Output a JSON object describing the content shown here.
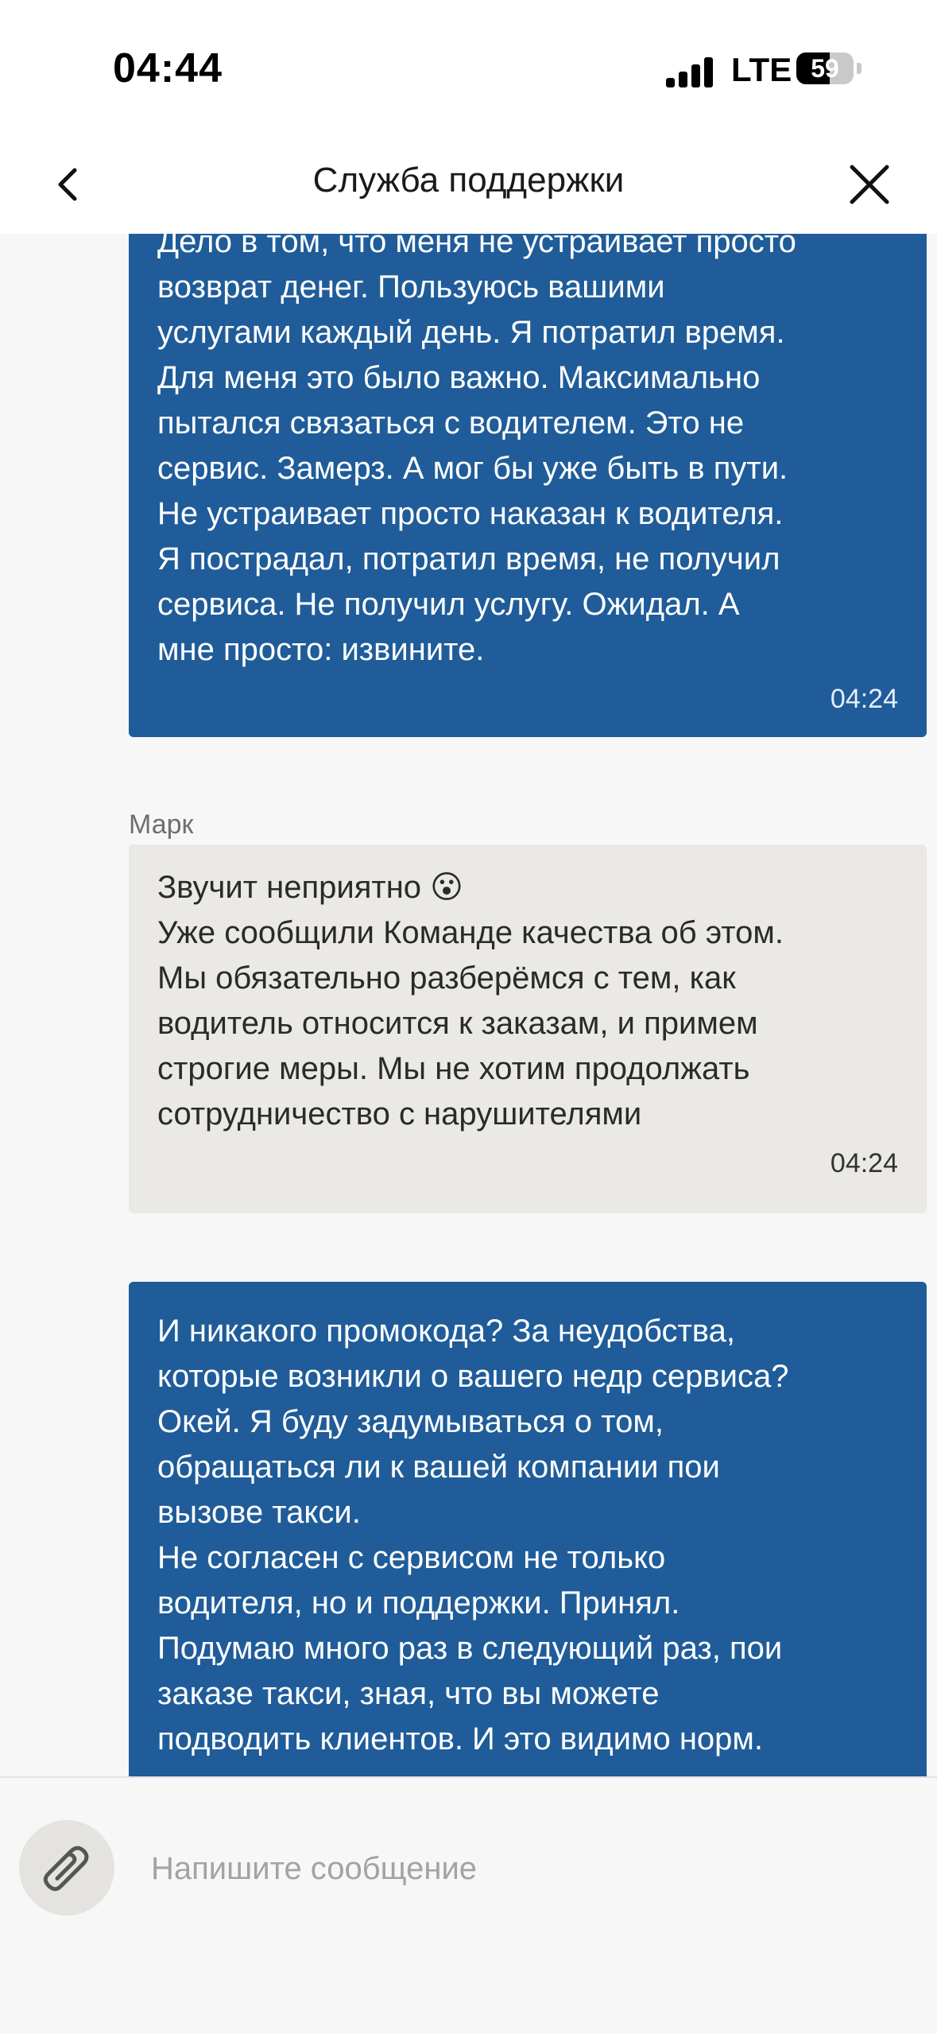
{
  "status_bar": {
    "time": "04:44",
    "network": "LTE",
    "battery": "59",
    "battery_level": 0.59
  },
  "header": {
    "title": "Служба поддержки",
    "back_icon": "chevron-left-icon",
    "close_icon": "close-icon"
  },
  "messages": [
    {
      "direction": "outgoing",
      "text": "Дело в том, что меня не устраивает просто\nвозврат денег. Пользуюсь вашими\nуслугами каждый день. Я потратил время.\nДля меня это было важно. Максимально\nпытался связаться с водителем. Это не\nсервис. Замерз. А мог бы уже быть в пути.\nНе устраивает просто наказан к водителя.\nЯ пострадал, потратил время, не получил\nсервиса. Не получил услугу. Ожидал. А\nмне просто: извините.",
      "time": "04:24"
    },
    {
      "direction": "incoming",
      "sender": "Марк",
      "text": "Звучит неприятно 😮\nУже сообщили Команде качества об этом.\nМы обязательно разберёмся с тем, как\nводитель относится к заказам, и примем\nстрогие меры. Мы не хотим продолжать\nсотрудничество с нарушителями",
      "time": "04:24"
    },
    {
      "direction": "outgoing",
      "text": "И никакого промокода? За неудобства,\nкоторые возникли о вашего недр сервиса?\nОкей. Я буду задумываться о том,\nобращаться ли к вашей компании пои\nвызове такси.\nНе согласен с сервисом не только\nводителя, но и поддержки. Принял.\nПодумаю много раз в следующий раз, пои\nзаказе такси, зная, что вы можете\nподводить клиентов. И это видимо норм."
    }
  ],
  "composer": {
    "placeholder": "Напишите сообщение",
    "attach_icon": "paperclip-icon"
  },
  "colors": {
    "outgoing_bubble": "#1f5c99",
    "incoming_bubble": "#ebe9e5",
    "background": "#f7f7f7"
  }
}
